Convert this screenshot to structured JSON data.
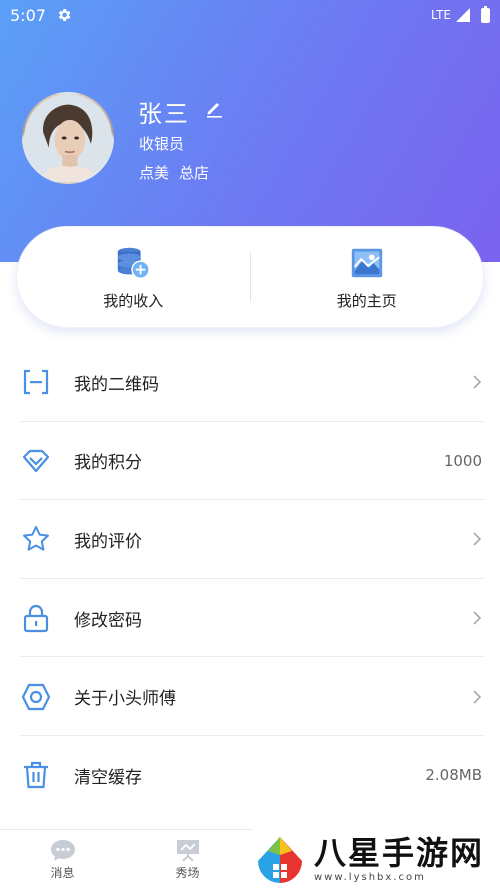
{
  "status_bar": {
    "time": "5:07",
    "network": "LTE"
  },
  "profile": {
    "name": "张三",
    "role": "收银员",
    "store": [
      "点美",
      "总店"
    ]
  },
  "card": {
    "income_label": "我的收入",
    "homepage_label": "我的主页"
  },
  "menu": [
    {
      "label": "我的二维码",
      "value": "",
      "icon": "qrcode-scan-icon",
      "chevron": true
    },
    {
      "label": "我的积分",
      "value": "1000",
      "icon": "diamond-icon",
      "chevron": false
    },
    {
      "label": "我的评价",
      "value": "",
      "icon": "star-icon",
      "chevron": true
    },
    {
      "label": "修改密码",
      "value": "",
      "icon": "lock-icon",
      "chevron": true
    },
    {
      "label": "关于小头师傅",
      "value": "",
      "icon": "hexagon-icon",
      "chevron": true
    },
    {
      "label": "清空缓存",
      "value": "2.08MB",
      "icon": "trash-icon",
      "chevron": false
    }
  ],
  "tabs": [
    {
      "label": "消息",
      "icon": "chat-bubble-icon"
    },
    {
      "label": "秀场",
      "icon": "easel-icon"
    }
  ],
  "watermark": {
    "text": "八星手游网",
    "url": "www.lyshbx.com"
  },
  "colors": {
    "accent": "#4a90e2",
    "gradient_start": "#5aa0f7",
    "gradient_end": "#7b63ef"
  }
}
